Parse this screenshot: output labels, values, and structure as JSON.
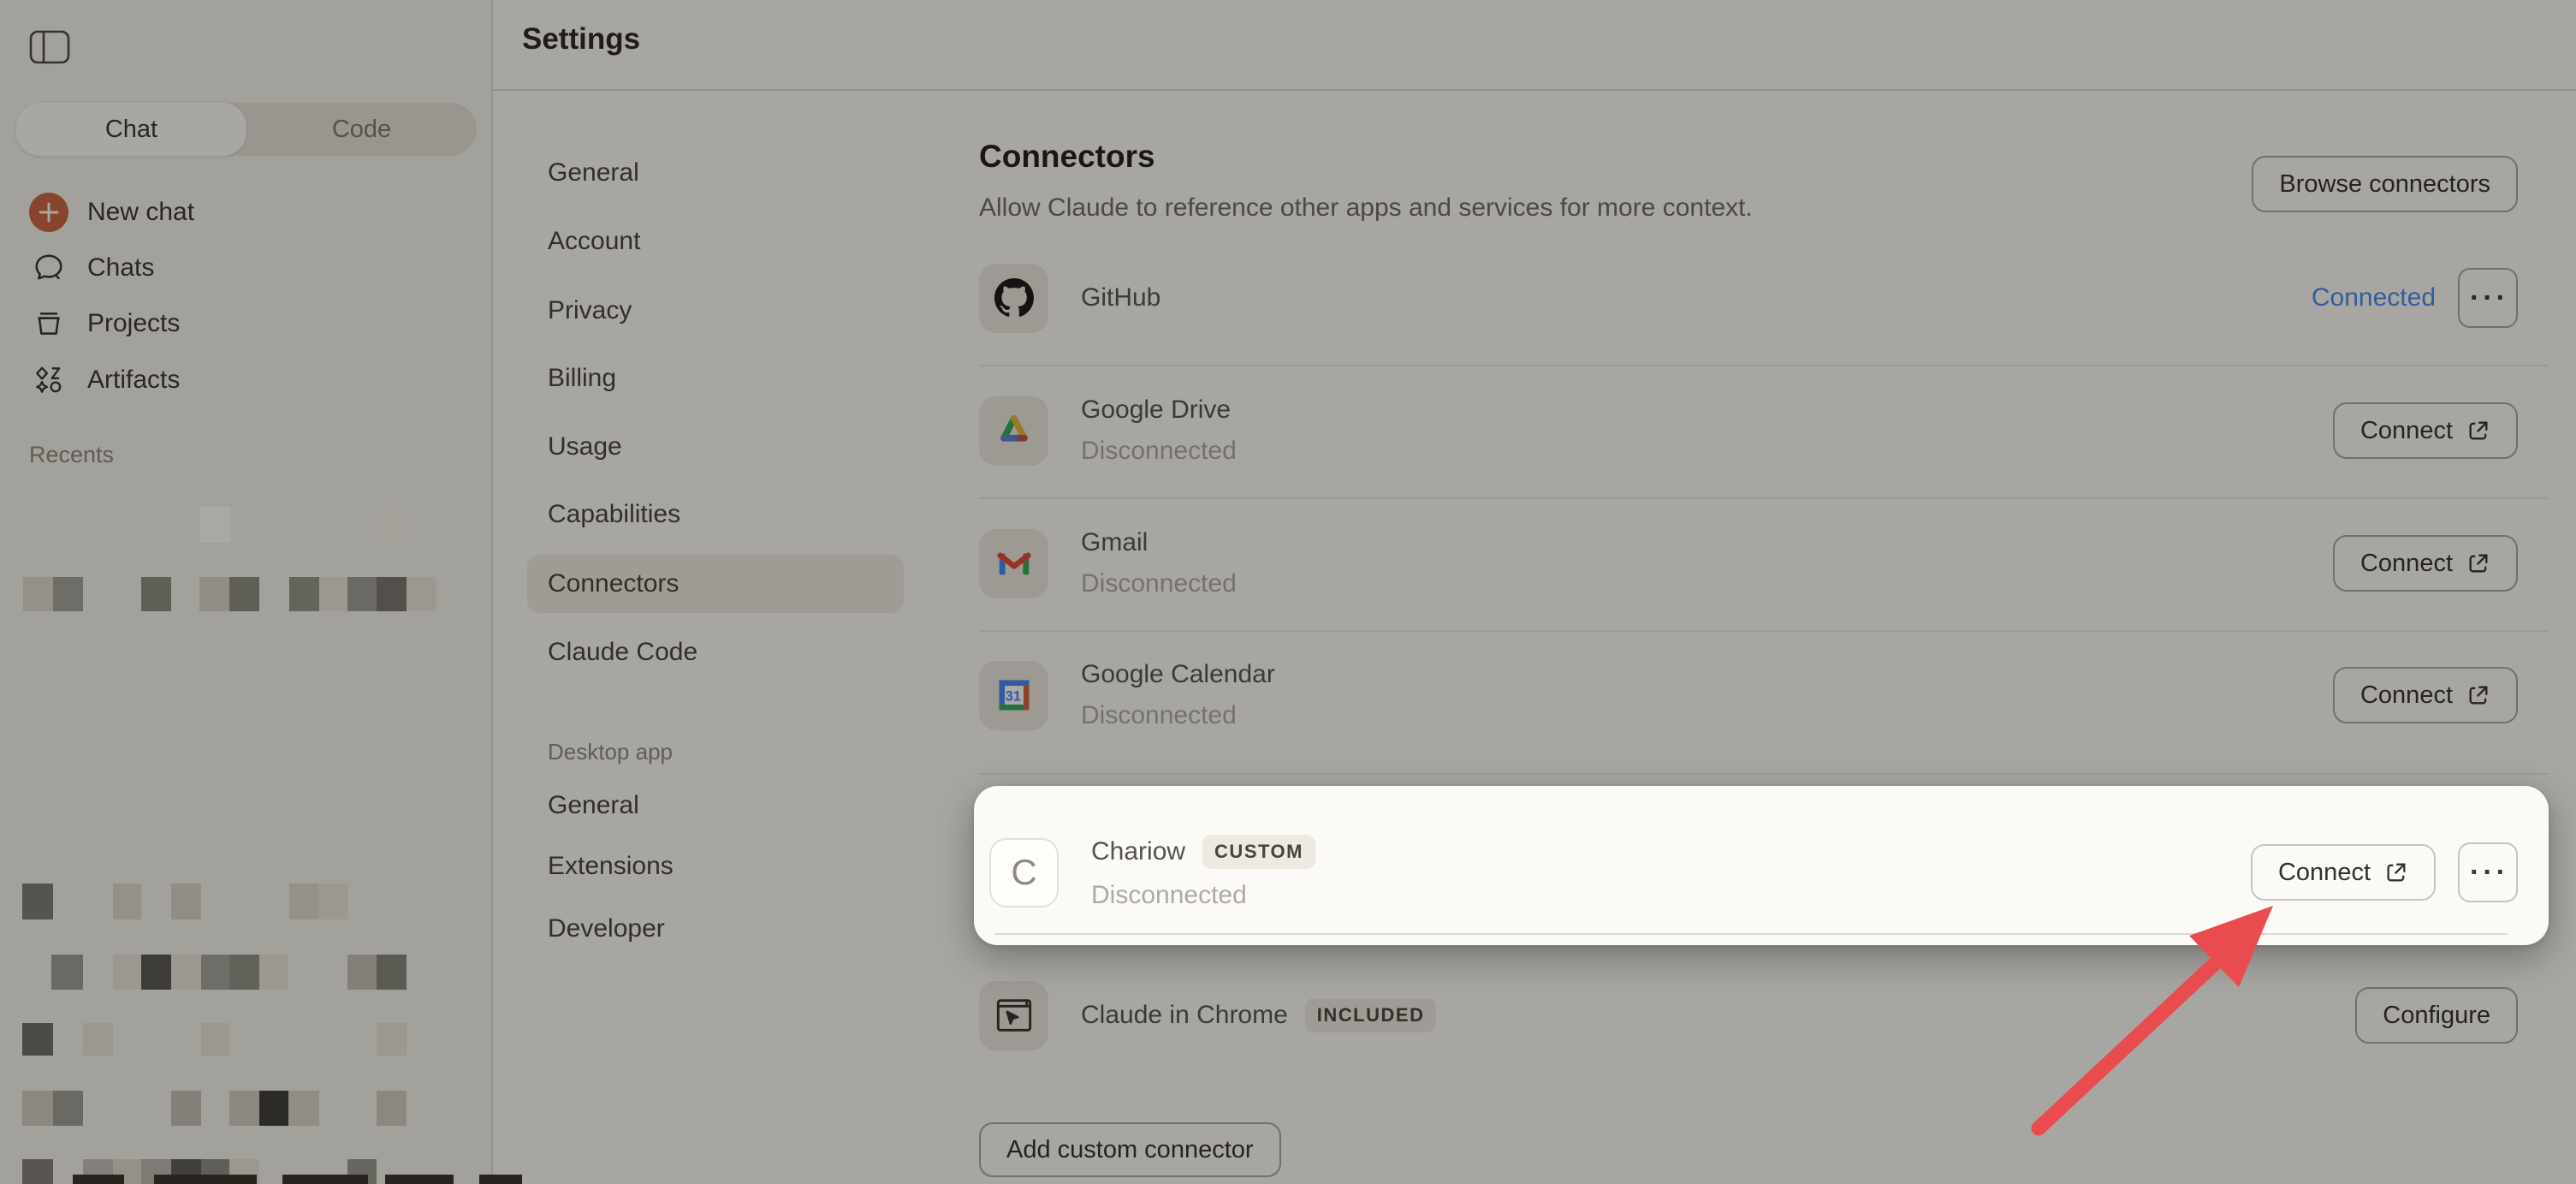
{
  "sidebar": {
    "mode_toggle": {
      "chat_label": "Chat",
      "code_label": "Code",
      "active": "Chat"
    },
    "new_chat_label": "New chat",
    "items": [
      {
        "label": "Chats"
      },
      {
        "label": "Projects"
      },
      {
        "label": "Artifacts"
      }
    ],
    "recents_label": "Recents",
    "redacted_blocks": [
      [
        233,
        592,
        37,
        42,
        "#fdfcf6"
      ],
      [
        440,
        592,
        35,
        42,
        "#f4f2e8"
      ],
      [
        27,
        674,
        35,
        40,
        "#dbd9cd"
      ],
      [
        62,
        674,
        35,
        40,
        "#a1a19a"
      ],
      [
        165,
        674,
        35,
        40,
        "#8a8a82"
      ],
      [
        233,
        674,
        35,
        40,
        "#d5d3c7"
      ],
      [
        268,
        674,
        35,
        40,
        "#8a8a82"
      ],
      [
        338,
        674,
        35,
        40,
        "#939389"
      ],
      [
        373,
        674,
        33,
        40,
        "#e6e4d8"
      ],
      [
        406,
        674,
        34,
        40,
        "#9b9b94"
      ],
      [
        440,
        674,
        35,
        40,
        "#79766f"
      ],
      [
        475,
        674,
        35,
        40,
        "#e6e4d8"
      ],
      [
        26,
        1032,
        36,
        42,
        "#7b7b73"
      ],
      [
        132,
        1032,
        33,
        42,
        "#dbd9cd"
      ],
      [
        200,
        1032,
        35,
        42,
        "#d5d3c7"
      ],
      [
        338,
        1032,
        34,
        42,
        "#dbd9cd"
      ],
      [
        372,
        1032,
        35,
        42,
        "#e6e4d8"
      ],
      [
        60,
        1115,
        37,
        41,
        "#9b9b94"
      ],
      [
        132,
        1115,
        33,
        41,
        "#e6e4d8"
      ],
      [
        165,
        1115,
        35,
        41,
        "#585751"
      ],
      [
        200,
        1115,
        35,
        41,
        "#e6e4d8"
      ],
      [
        235,
        1115,
        33,
        41,
        "#a1a19a"
      ],
      [
        268,
        1115,
        35,
        41,
        "#908f86"
      ],
      [
        303,
        1115,
        33,
        41,
        "#e6e4d8"
      ],
      [
        406,
        1115,
        34,
        41,
        "#c0bfb4"
      ],
      [
        440,
        1115,
        35,
        41,
        "#85847c"
      ],
      [
        26,
        1195,
        36,
        38,
        "#6f6e67"
      ],
      [
        97,
        1195,
        35,
        38,
        "#e6e4d8"
      ],
      [
        235,
        1195,
        33,
        38,
        "#e6e4d8"
      ],
      [
        440,
        1195,
        35,
        38,
        "#e6e4d8"
      ],
      [
        26,
        1274,
        36,
        41,
        "#cecbbf"
      ],
      [
        62,
        1274,
        35,
        41,
        "#9b9b94"
      ],
      [
        200,
        1274,
        35,
        41,
        "#c0bfb4"
      ],
      [
        268,
        1274,
        35,
        41,
        "#cecbbf"
      ],
      [
        303,
        1274,
        34,
        41,
        "#3d3c38"
      ],
      [
        337,
        1274,
        36,
        41,
        "#d5d3c7"
      ],
      [
        440,
        1274,
        35,
        41,
        "#cecbbf"
      ],
      [
        26,
        1354,
        36,
        29,
        "#827f78"
      ],
      [
        97,
        1354,
        35,
        29,
        "#c0bfb4"
      ],
      [
        132,
        1354,
        33,
        29,
        "#dbd9cd"
      ],
      [
        165,
        1354,
        35,
        29,
        "#b8b7ac"
      ],
      [
        200,
        1354,
        35,
        29,
        "#5e5d57"
      ],
      [
        235,
        1354,
        33,
        29,
        "#8a8a82"
      ],
      [
        268,
        1354,
        35,
        29,
        "#e6e4d8"
      ],
      [
        406,
        1354,
        34,
        29,
        "#99988e"
      ],
      [
        85,
        1372,
        60,
        11,
        "#36342e"
      ],
      [
        180,
        1372,
        120,
        11,
        "#36342e"
      ],
      [
        330,
        1372,
        100,
        11,
        "#36342e"
      ],
      [
        450,
        1372,
        80,
        11,
        "#36342e"
      ],
      [
        560,
        1372,
        50,
        11,
        "#36342e"
      ]
    ]
  },
  "header": {
    "title": "Settings"
  },
  "settings_nav": {
    "account_items": [
      "General",
      "Account",
      "Privacy",
      "Billing",
      "Usage",
      "Capabilities",
      "Connectors",
      "Claude Code"
    ],
    "selected_item": "Connectors",
    "desktop_section_label": "Desktop app",
    "desktop_items": [
      "General",
      "Extensions",
      "Developer"
    ]
  },
  "main": {
    "heading": "Connectors",
    "description": "Allow Claude to reference other apps and services for more context.",
    "browse_button_label": "Browse connectors",
    "connect_label": "Connect",
    "configure_label": "Configure",
    "add_custom_label": "Add custom connector",
    "menu_icon_label": "···",
    "connected_color": "#4a87f0",
    "calendar_icon_day": "31",
    "rows": [
      {
        "name": "GitHub",
        "status": "Connected"
      },
      {
        "name": "Google Drive",
        "status": "Disconnected"
      },
      {
        "name": "Gmail",
        "status": "Disconnected"
      },
      {
        "name": "Google Calendar",
        "status": "Disconnected"
      },
      {
        "name": "Chariow",
        "badge": "CUSTOM",
        "status": "Disconnected",
        "icon_letter": "C"
      },
      {
        "name": "Claude in Chrome",
        "badge": "INCLUDED"
      }
    ]
  },
  "annotation": {
    "arrow_color": "#ea4b4e"
  }
}
